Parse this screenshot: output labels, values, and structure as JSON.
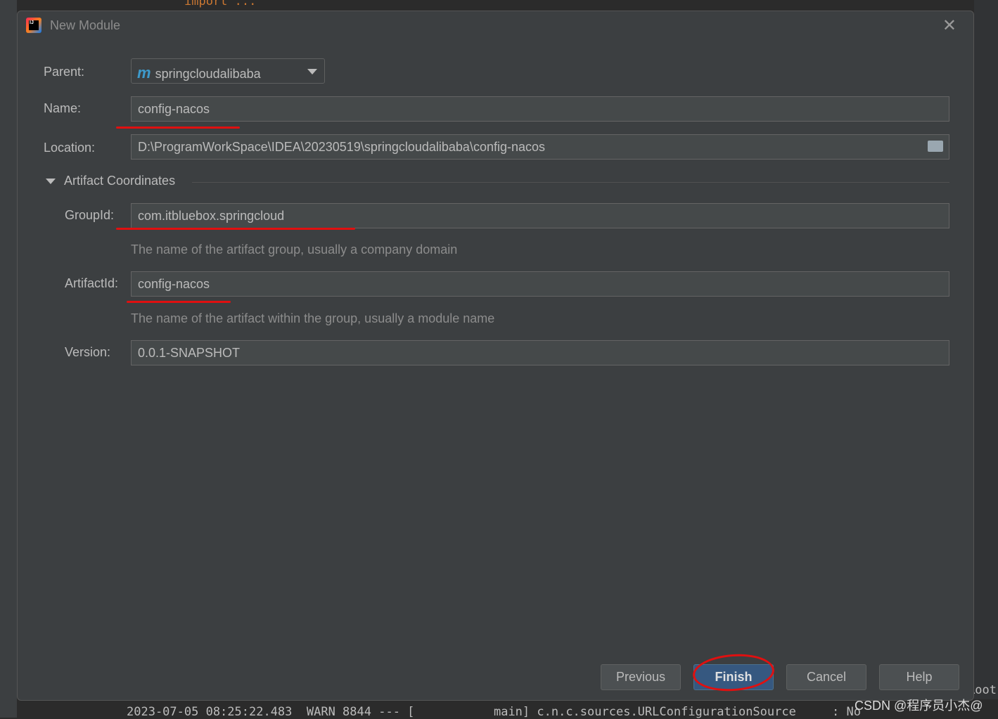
{
  "background": {
    "code_line": "import ...",
    "console_line": "2023-07-05 08:25:22.483  WARN 8844 --- [           main] c.n.c.sources.URLConfigurationSource     : No",
    "right_fragment": "Root"
  },
  "dialog": {
    "title": "New Module",
    "close_icon": "close-icon"
  },
  "form": {
    "parent_label": "Parent:",
    "parent_value": "springcloudalibaba",
    "parent_icon": "maven-module-icon",
    "name_label": "Name:",
    "name_value": "config-nacos",
    "location_label": "Location:",
    "location_value": "D:\\ProgramWorkSpace\\IDEA\\20230519\\springcloudalibaba\\config-nacos",
    "section_title": "Artifact Coordinates",
    "groupid_label": "GroupId:",
    "groupid_value": "com.itbluebox.springcloud",
    "groupid_hint": "The name of the artifact group, usually a company domain",
    "artifactid_label": "ArtifactId:",
    "artifactid_value": "config-nacos",
    "artifactid_hint": "The name of the artifact within the group, usually a module name",
    "version_label": "Version:",
    "version_value": "0.0.1-SNAPSHOT"
  },
  "buttons": {
    "previous": "Previous",
    "finish": "Finish",
    "cancel": "Cancel",
    "help": "Help"
  },
  "colors": {
    "accent": "#365880",
    "annotation": "#e01010"
  },
  "watermark": "CSDN @程序员小杰@"
}
